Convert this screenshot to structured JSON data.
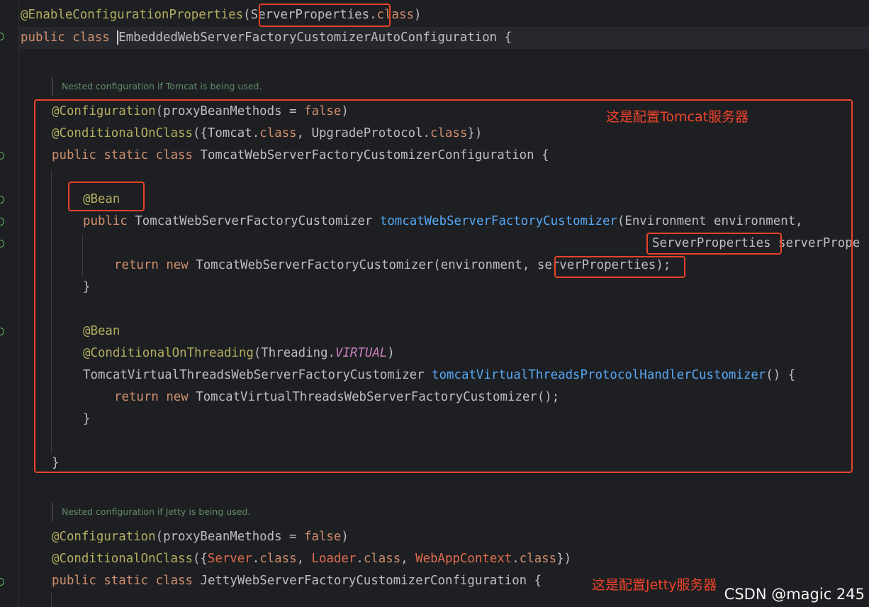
{
  "code_lines": {
    "l01": {
      "ann": "@EnableConfigurationProperties",
      "paren": "(",
      "server_properties": "ServerProperties",
      "dot": ".",
      "kw_class": "class",
      "close": ")"
    },
    "l02": {
      "kw_public": "public",
      "kw_class": "class",
      "class_name": "EmbeddedWebServerFactoryCustomizerAutoConfiguration",
      "brace": " {"
    },
    "doc1": "Nested configuration if Tomcat is being used.",
    "l03": {
      "ann": "@Configuration",
      "open": "(proxyBeanMethods = ",
      "kw_false": "false",
      "close": ")"
    },
    "l04": {
      "ann": "@ConditionalOnClass",
      "open": "({Tomcat.",
      "kw_class1": "class",
      "mid": ", UpgradeProtocol.",
      "kw_class2": "class",
      "close": "})"
    },
    "l05": {
      "kw_public": "public",
      "kw_static": "static",
      "kw_class": "class",
      "class_name": "TomcatWebServerFactoryCustomizerConfiguration",
      "brace": " {"
    },
    "l06": {
      "ann": "@Bean"
    },
    "l07": {
      "kw_public": "public",
      "type": "TomcatWebServerFactoryCustomizer",
      "method": "tomcatWebServerFactoryCustomizer",
      "params": "(Environment environment,"
    },
    "l08": {
      "type": "ServerProperties",
      "rest": " serverPrope"
    },
    "l09": {
      "kw_return": "return",
      "kw_new": "new",
      "call": "TomcatWebServerFactoryCustomizer(environment, ",
      "arg": "serverProperties",
      "end": ");"
    },
    "l10": "}",
    "l11": {
      "ann": "@Bean"
    },
    "l12": {
      "ann": "@ConditionalOnThreading",
      "open": "(Threading.",
      "const": "VIRTUAL",
      "close": ")"
    },
    "l13": {
      "type": "TomcatVirtualThreadsWebServerFactoryCustomizer",
      "method": "tomcatVirtualThreadsProtocolHandlerCustomizer",
      "rest": "() {"
    },
    "l14": {
      "kw_return": "return",
      "kw_new": "new",
      "call": "TomcatVirtualThreadsWebServerFactoryCustomizer();"
    },
    "l15": "}",
    "l16": "}",
    "doc2": "Nested configuration if Jetty is being used.",
    "l17": {
      "ann": "@Configuration",
      "open": "(proxyBeanMethods = ",
      "kw_false": "false",
      "close": ")"
    },
    "l18": {
      "ann": "@ConditionalOnClass",
      "open": "({",
      "c1": "Server",
      "dot1": ".",
      "kw1": "class",
      "sep1": ", ",
      "c2": "Loader",
      "dot2": ".",
      "kw2": "class",
      "sep2": ", ",
      "c3": "WebAppContext",
      "dot3": ".",
      "kw3": "class",
      "close": "})"
    },
    "l19": {
      "kw_public": "public",
      "kw_static": "static",
      "kw_class": "class",
      "class_name": "JettyWebServerFactoryCustomizerConfiguration",
      "brace": " {"
    }
  },
  "annotations": {
    "tomcat_note": "这是配置Tomcat服务器",
    "jetty_note": "这是配置Jetty服务器"
  },
  "watermark": "CSDN @magic 245",
  "colors": {
    "background": "#1e1f22",
    "keyword": "#cf8e6d",
    "annotation": "#b3ae60",
    "method": "#56a8f5",
    "constant": "#c77dbb",
    "highlight_box": "#e8432a"
  }
}
